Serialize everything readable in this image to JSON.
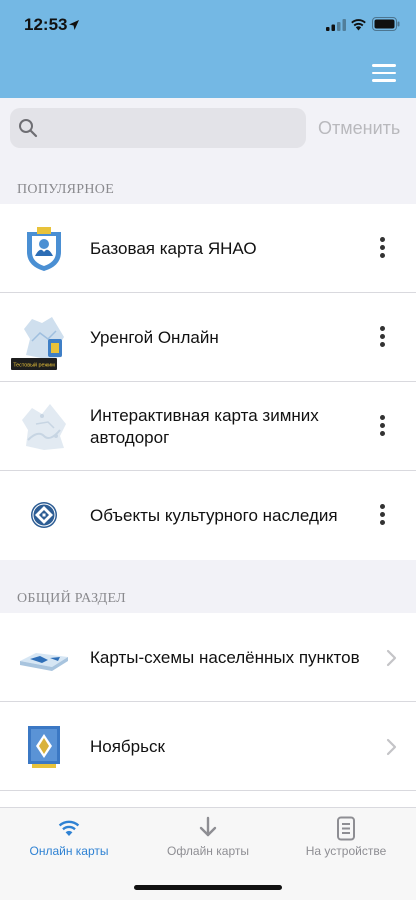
{
  "status_bar": {
    "time": "12:53"
  },
  "search": {
    "placeholder": "",
    "cancel_label": "Отменить"
  },
  "sections": {
    "popular": {
      "title": "ПОПУЛЯРНОЕ",
      "items": [
        {
          "label": "Базовая карта ЯНАО",
          "icon": "yanao-emblem-icon"
        },
        {
          "label": "Уренгой Онлайн",
          "icon": "urengoy-map-icon",
          "badge": "Тестовый режим"
        },
        {
          "label": "Интерактивная карта зимних автодорог",
          "icon": "winter-roads-map-icon"
        },
        {
          "label": "Объекты культурного наследия",
          "icon": "heritage-emblem-icon"
        }
      ]
    },
    "general": {
      "title": "ОБЩИЙ РАЗДЕЛ",
      "items": [
        {
          "label": "Карты-схемы населённых пунктов",
          "icon": "settlement-map-icon"
        },
        {
          "label": "Ноябрьск",
          "icon": "noyabrsk-coat-of-arms-icon"
        }
      ]
    }
  },
  "tabs": [
    {
      "label": "Онлайн карты",
      "icon": "wifi-icon",
      "active": true
    },
    {
      "label": "Офлайн карты",
      "icon": "download-arrow-icon",
      "active": false
    },
    {
      "label": "На устройстве",
      "icon": "device-document-icon",
      "active": false
    }
  ],
  "colors": {
    "header": "#74b8e4",
    "accent": "#2f82d3",
    "muted": "#8e8e93"
  }
}
